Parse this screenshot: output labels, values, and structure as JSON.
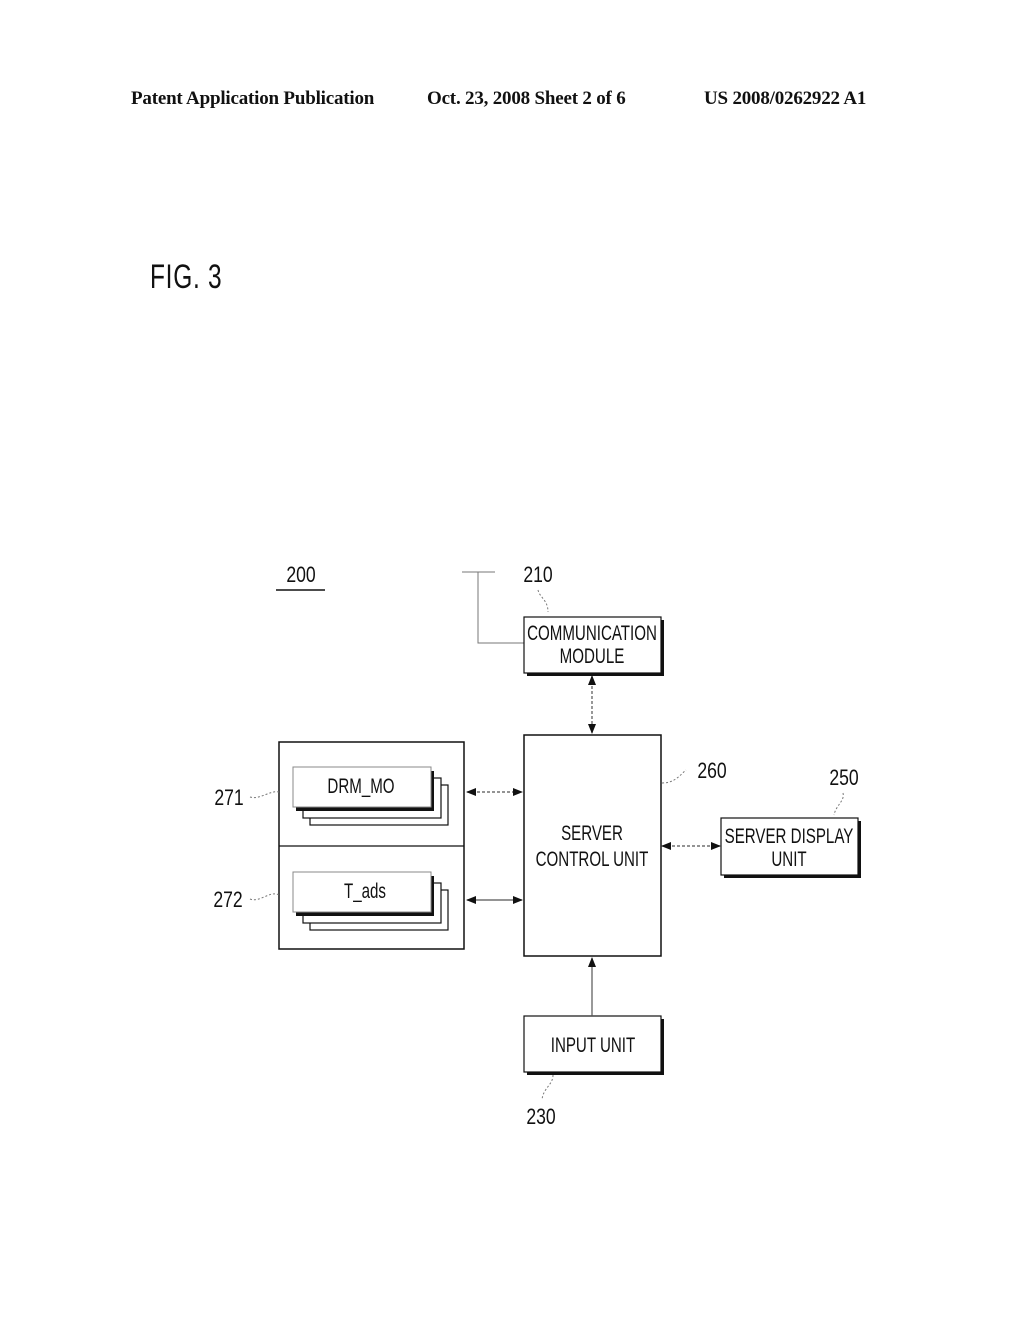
{
  "header": {
    "publication": "Patent Application Publication",
    "date_sheet": "Oct. 23, 2008   Sheet 2 of 6",
    "number": "US 2008/0262922 A1"
  },
  "figure": {
    "title": "FIG. 3",
    "system_ref": "200",
    "blocks": {
      "communication_module": {
        "ref": "210",
        "line1": "COMMUNICATION",
        "line2": "MODULE"
      },
      "server_control_unit": {
        "ref": "260",
        "line1": "SERVER",
        "line2": "CONTROL UNIT"
      },
      "server_display_unit": {
        "ref": "250",
        "line1": "SERVER DISPLAY",
        "line2": "UNIT"
      },
      "input_unit": {
        "ref": "230",
        "line1": "INPUT UNIT"
      },
      "drm_mo": {
        "ref": "271",
        "label": "DRM_MO"
      },
      "t_ads": {
        "ref": "272",
        "label": "T_ads"
      }
    }
  }
}
